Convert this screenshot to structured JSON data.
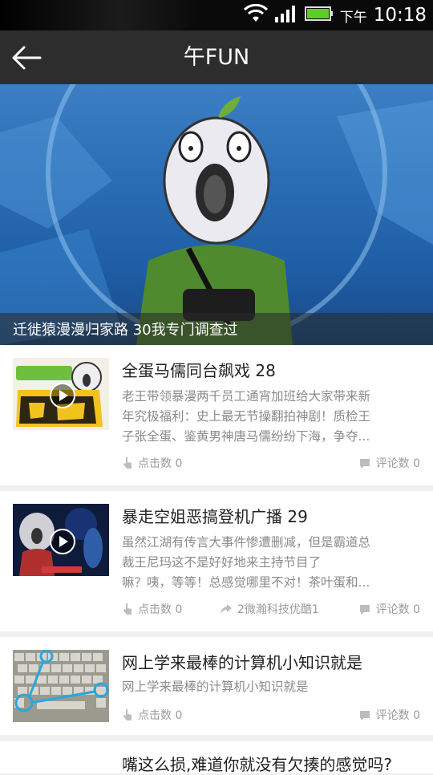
{
  "status_bar": {
    "ampm": "下午",
    "time": "10:18"
  },
  "header": {
    "title": "午FUN"
  },
  "hero": {
    "caption": "迁徙猿漫漫归家路 30我专门调查过"
  },
  "colors": {
    "header_bg": "#2d2d2d",
    "status_bg": "#0a0a0a",
    "card_bg": "#ffffff",
    "separator": "#f0f0f0",
    "meta_text": "#9a9a9a"
  },
  "items": [
    {
      "title": "全蛋马儒同台飙戏 28",
      "desc_lines": [
        "老王带领暴漫两千员工通宵加班给大家带来新",
        "年究极福利：史上最无节操翻拍神剧！质检王",
        "子张全蛋、鉴黄男神唐马儒纷纷下海，争夺..."
      ],
      "clicks": "点击数 0",
      "comments": "评论数 0",
      "has_play": true
    },
    {
      "title": "暴走空姐恶搞登机广播  29",
      "desc_lines": [
        "虽然江湖有传言大事件惨遭删减，但是霸道总",
        "裁王尼玛这不是好好地来主持节目了",
        "嘛？咦，等等！总感觉哪里不对！茶叶蛋和..."
      ],
      "clicks": "点击数 0",
      "share": "2微瀚科技优酷1",
      "comments": "评论数 0",
      "has_play": true
    },
    {
      "title": "网上学来最棒的计算机小知识就是",
      "desc_lines": [
        "网上学来最棒的计算机小知识就是"
      ],
      "clicks": "点击数 0",
      "comments": "评论数 0",
      "has_play": false
    },
    {
      "title": "嘴这么损,难道你就没有欠揍的感觉吗?"
    }
  ]
}
